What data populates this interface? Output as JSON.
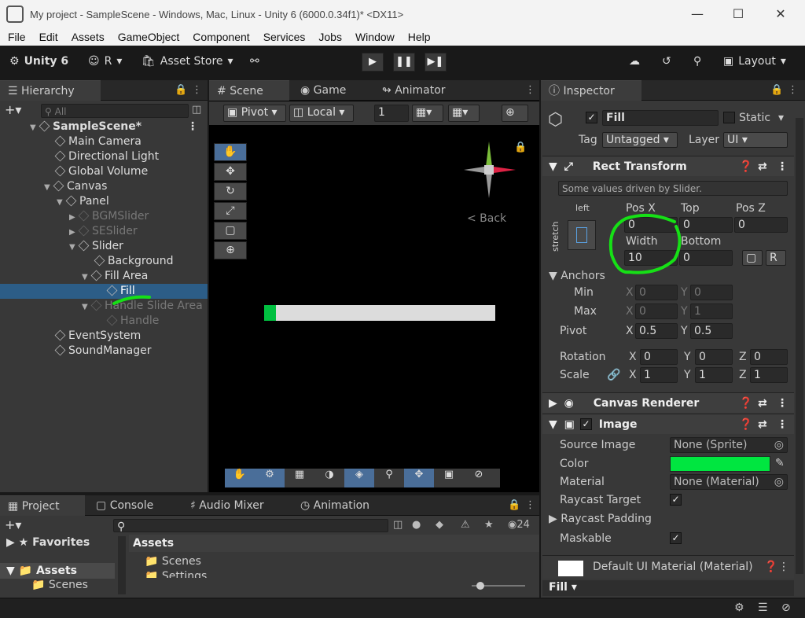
{
  "window": {
    "title": "My project - SampleScene - Windows, Mac, Linux - Unity 6 (6000.0.34f1)* <DX11>"
  },
  "menu": [
    "File",
    "Edit",
    "Assets",
    "GameObject",
    "Component",
    "Services",
    "Jobs",
    "Window",
    "Help"
  ],
  "toolbar": {
    "unity_label": "Unity 6",
    "account": "R",
    "asset_store": "Asset Store",
    "layout": "Layout"
  },
  "hierarchy": {
    "tab": "Hierarchy",
    "search_placeholder": "All",
    "rows": [
      {
        "label": "SampleScene*"
      },
      {
        "label": "Main Camera"
      },
      {
        "label": "Directional Light"
      },
      {
        "label": "Global Volume"
      },
      {
        "label": "Canvas"
      },
      {
        "label": "Panel"
      },
      {
        "label": "BGMSlider"
      },
      {
        "label": "SESlider"
      },
      {
        "label": "Slider"
      },
      {
        "label": "Background"
      },
      {
        "label": "Fill Area"
      },
      {
        "label": "Fill"
      },
      {
        "label": "Handle Slide Area"
      },
      {
        "label": "Handle"
      },
      {
        "label": "EventSystem"
      },
      {
        "label": "SoundManager"
      }
    ]
  },
  "scene": {
    "tabs": [
      "Scene",
      "Game",
      "Animator"
    ],
    "pivot": "Pivot",
    "local": "Local",
    "grid_value": "1",
    "back": "< Back",
    "slider_fill_fraction": 0.05
  },
  "bottom": {
    "tabs": [
      "Project",
      "Console",
      "Audio Mixer",
      "Animation"
    ],
    "favorites": "Favorites",
    "assets": "Assets",
    "scenes": "Scenes",
    "settings": "Settings",
    "assets_header": "Assets",
    "count": "24"
  },
  "inspector": {
    "tab": "Inspector",
    "object_name": "Fill",
    "static": "Static",
    "tag_label": "Tag",
    "tag": "Untagged",
    "layer_label": "Layer",
    "layer": "UI",
    "rect_transform": "Rect Transform",
    "driven_note": "Some values driven by Slider.",
    "anchor_h": "left",
    "anchor_v": "stretch",
    "pos_x_label": "Pos X",
    "pos_x": "0",
    "top_label": "Top",
    "top": "0",
    "pos_z_label": "Pos Z",
    "pos_z": "0",
    "width_label": "Width",
    "width": "10",
    "bottom_label": "Bottom",
    "bottom": "0",
    "anchors": "Anchors",
    "min": "Min",
    "min_x": "0",
    "min_y": "0",
    "max": "Max",
    "max_x": "0",
    "max_y": "1",
    "pivot": "Pivot",
    "pivot_x": "0.5",
    "pivot_y": "0.5",
    "rotation": "Rotation",
    "rot_x": "0",
    "rot_y": "0",
    "rot_z": "0",
    "scale": "Scale",
    "scale_x": "1",
    "scale_y": "1",
    "scale_z": "1",
    "x": "X",
    "y": "Y",
    "z": "Z",
    "r": "R",
    "canvas_renderer": "Canvas Renderer",
    "image": "Image",
    "source_image_label": "Source Image",
    "source_image": "None (Sprite)",
    "color_label": "Color",
    "color_hex": "#00e640",
    "material_label": "Material",
    "material": "None (Material)",
    "raycast_target": "Raycast Target",
    "raycast_padding": "Raycast Padding",
    "maskable": "Maskable",
    "default_material": "Default UI Material (Material)",
    "footer": "Fill"
  },
  "colors": {
    "annotation": "#16e016",
    "selection": "#2c5d87",
    "slider_fill": "#00c040"
  }
}
